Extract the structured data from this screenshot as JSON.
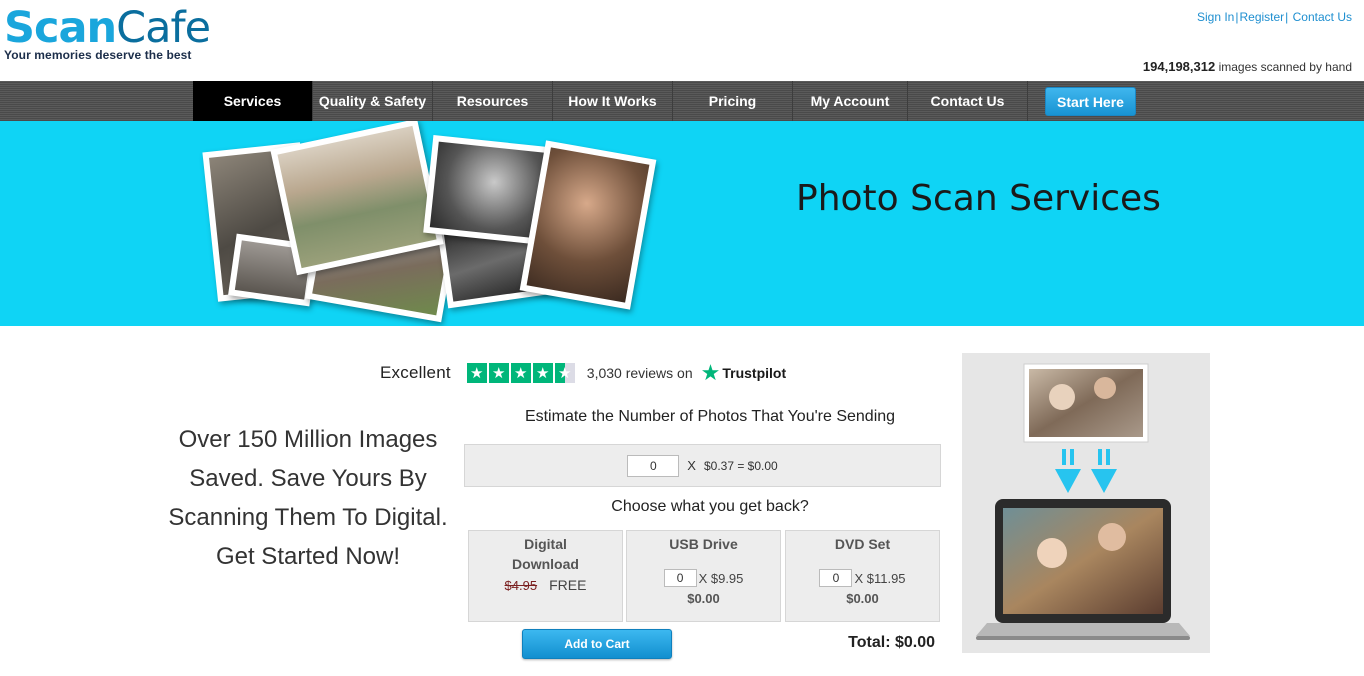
{
  "brand": {
    "name_part1": "Scan",
    "name_part2": "Cafe",
    "tagline": "Your memories deserve the best",
    "accent_color": "#1aa6dc"
  },
  "top_links": {
    "sign_in": "Sign In",
    "register": "Register",
    "contact": "Contact Us"
  },
  "counter": {
    "value": "194,198,312",
    "label": "images scanned by hand"
  },
  "nav": {
    "items": [
      {
        "label": "Services",
        "active": true
      },
      {
        "label": "Quality & Safety",
        "active": false
      },
      {
        "label": "Resources",
        "active": false
      },
      {
        "label": "How It Works",
        "active": false
      },
      {
        "label": "Pricing",
        "active": false
      },
      {
        "label": "My Account",
        "active": false
      },
      {
        "label": "Contact Us",
        "active": false
      }
    ],
    "cta": "Start Here"
  },
  "hero": {
    "title": "Photo Scan Services",
    "background_color": "#0fd4f5"
  },
  "trustpilot": {
    "rating_word": "Excellent",
    "stars": 4.5,
    "reviews_text": "3,030 reviews on",
    "brand": "Trustpilot",
    "star_icon": "star-icon"
  },
  "promo": {
    "text": "Over 150 Million Images Saved. Save Yours By Scanning Them To Digital. Get Started Now!"
  },
  "estimator": {
    "title": "Estimate the Number of Photos That You're Sending",
    "quantity": "0",
    "multiplier": "X",
    "price": "$0.37 = $0.00"
  },
  "choose": {
    "title": "Choose what you get back?",
    "options": [
      {
        "title": "Digital Download",
        "old_price": "$4.95",
        "new_price": "FREE"
      },
      {
        "title": "USB Drive",
        "quantity": "0",
        "unit_price": "X $9.95",
        "subtotal": "$0.00"
      },
      {
        "title": "DVD Set",
        "quantity": "0",
        "unit_price": "X $11.95",
        "subtotal": "$0.00"
      }
    ]
  },
  "cart": {
    "button": "Add to Cart",
    "total": "Total: $0.00"
  }
}
